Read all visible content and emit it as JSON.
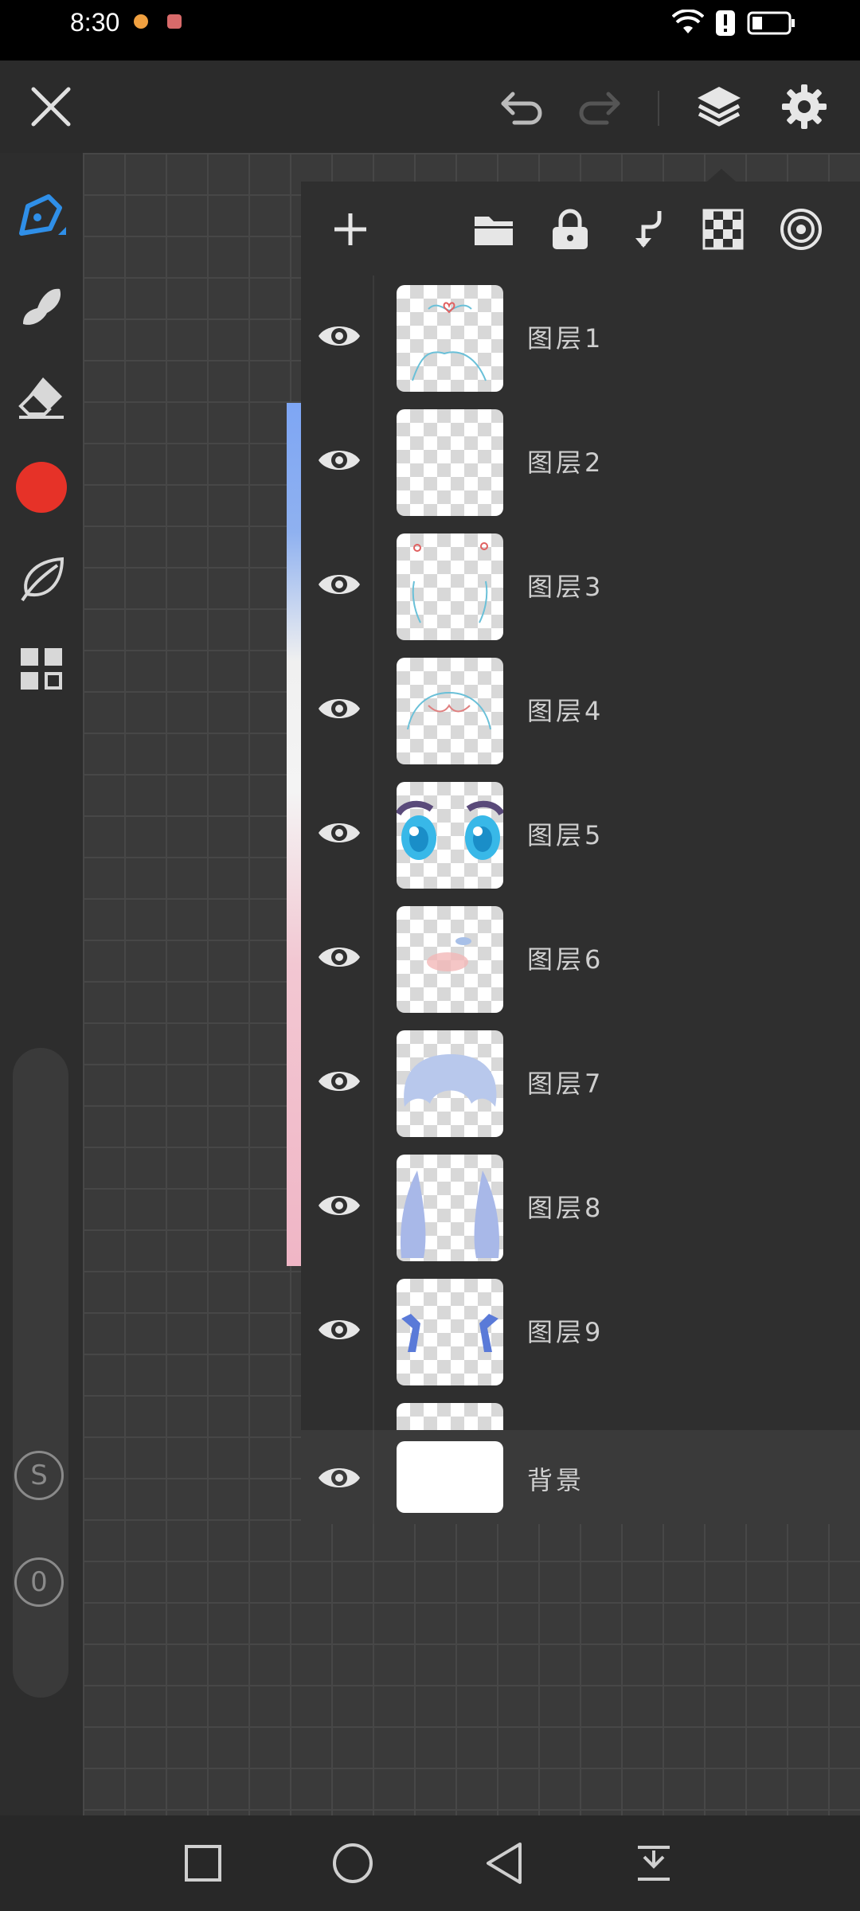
{
  "status_bar": {
    "time": "8:30",
    "icons": [
      "notification-icon-1",
      "notification-icon-2",
      "wifi-icon",
      "alert-icon",
      "battery-icon"
    ]
  },
  "top_bar": {
    "icons": [
      "close-icon",
      "undo-icon",
      "redo-icon",
      "layers-icon",
      "settings-icon"
    ]
  },
  "tool_rail": {
    "tools": [
      "pen-icon",
      "smudge-icon",
      "eraser-icon",
      "color-swatch",
      "leaf-icon",
      "gallery-grid-icon"
    ],
    "current_color": "#e63228",
    "size_label": "S",
    "opacity_label": "0"
  },
  "layers_toolbar": {
    "icons": [
      "add-icon",
      "folder-icon",
      "lock-icon",
      "merge-down-icon",
      "transparency-icon",
      "target-icon"
    ]
  },
  "layers": [
    {
      "name": "图层1"
    },
    {
      "name": "图层2"
    },
    {
      "name": "图层3"
    },
    {
      "name": "图层4"
    },
    {
      "name": "图层5"
    },
    {
      "name": "图层6"
    },
    {
      "name": "图层7"
    },
    {
      "name": "图层8"
    },
    {
      "name": "图层9"
    }
  ],
  "background_layer": {
    "name": "背景"
  },
  "nav_bar": {
    "icons": [
      "recents-icon",
      "home-icon",
      "back-icon",
      "dropdown-icon"
    ]
  },
  "colors": {
    "accent": "#2f8fe8",
    "brush_color": "#e63228"
  }
}
